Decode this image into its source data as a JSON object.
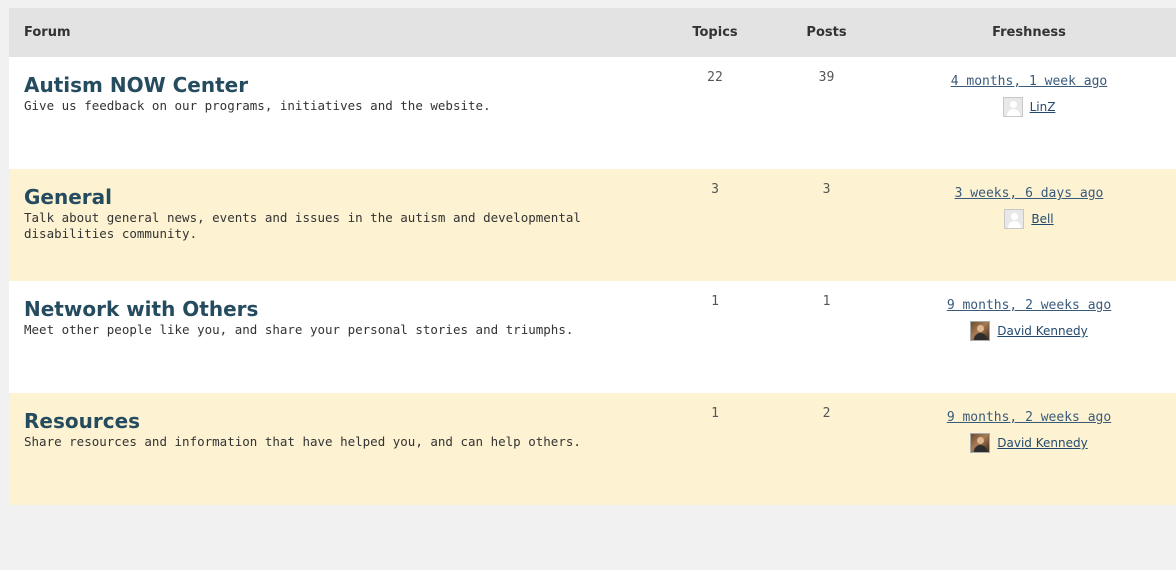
{
  "header": {
    "forum": "Forum",
    "topics": "Topics",
    "posts": "Posts",
    "freshness": "Freshness"
  },
  "forums": [
    {
      "title": "Autism NOW Center",
      "description": "Give us feedback on our programs, initiatives and the website.",
      "topics": "22",
      "posts": "39",
      "freshness": "4 months, 1 week ago",
      "author": "LinZ",
      "avatar": "default-avatar"
    },
    {
      "title": "General",
      "description": "Talk about general news, events and issues in the autism and developmental disabilities community.",
      "topics": "3",
      "posts": "3",
      "freshness": "3 weeks, 6 days ago",
      "author": "Bell",
      "avatar": "default-avatar"
    },
    {
      "title": "Network with Others",
      "description": "Meet other people like you, and share your personal stories and triumphs.",
      "topics": "1",
      "posts": "1",
      "freshness": "9 months, 2 weeks ago",
      "author": "David Kennedy",
      "avatar": "photo-avatar"
    },
    {
      "title": "Resources",
      "description": "Share resources and information that have helped you, and can help others.",
      "topics": "1",
      "posts": "2",
      "freshness": "9 months, 2 weeks ago",
      "author": "David Kennedy",
      "avatar": "photo-avatar"
    }
  ],
  "colors": {
    "header_bg": "#e3e3e3",
    "odd_row_bg": "#ffffff",
    "even_row_bg": "#fdf3d3",
    "title_color": "#254b5e",
    "page_bg": "#f1f1f1"
  }
}
